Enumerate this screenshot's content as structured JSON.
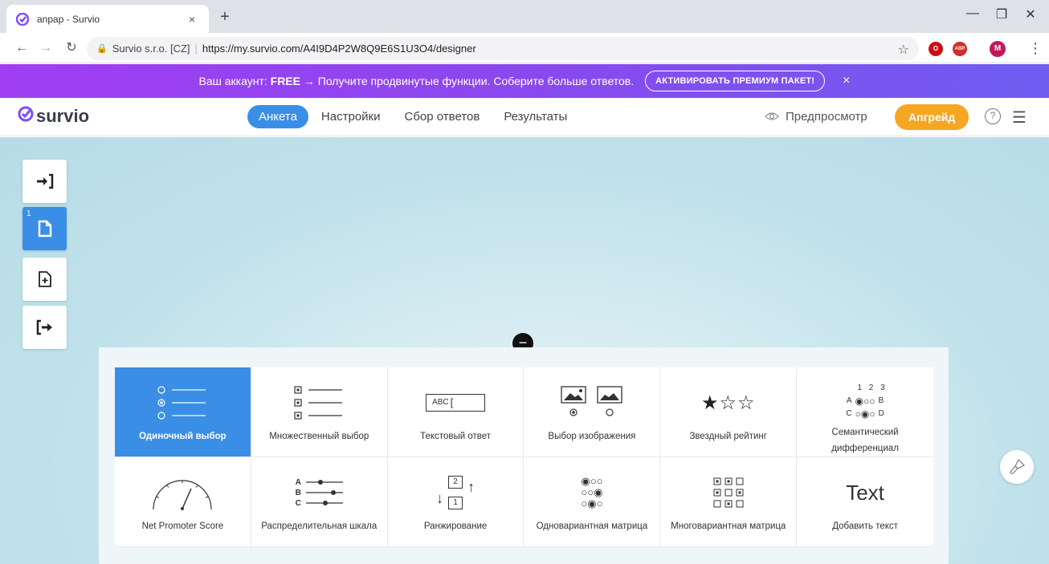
{
  "browser": {
    "tab_title": "anpap - Survio",
    "tab_close": "×",
    "new_tab": "+",
    "window_controls": {
      "minimize": "—",
      "restore": "❐",
      "close": "✕"
    },
    "nav": {
      "back": "←",
      "forward": "→",
      "reload": "↻"
    },
    "site_org": "Survio s.r.o. [CZ]",
    "url": "https://my.survio.com/A4I9D4P2W8Q9E6S1U3O4/designer",
    "extensions": [
      {
        "name": "opera-icon",
        "label": "O",
        "color": "#cc0f16"
      },
      {
        "name": "adblock-icon",
        "label": "ABP",
        "color": "#d62a2a"
      },
      {
        "name": "profile-avatar",
        "label": "M",
        "color": "#c2185b"
      }
    ]
  },
  "promo": {
    "text_prefix": "Ваш аккаунт:",
    "plan": "FREE",
    "text_suffix": "→ Получите продвинутые функции. Соберите больше ответов.",
    "cta": "АКТИВИРОВАТЬ ПРЕМИУМ ПАКЕТ!",
    "close": "×"
  },
  "header": {
    "logo": "survio",
    "tabs": [
      {
        "label": "Анкета",
        "active": true
      },
      {
        "label": "Настройки",
        "active": false
      },
      {
        "label": "Сбор ответов",
        "active": false
      },
      {
        "label": "Результаты",
        "active": false
      }
    ],
    "preview": "Предпросмотр",
    "upgrade": "Апгрейд",
    "help": "?"
  },
  "sidebar": {
    "page_number": "1",
    "buttons": [
      {
        "name": "sidebar-intro-button",
        "glyph": "→]"
      },
      {
        "name": "sidebar-page-button",
        "glyph": "page"
      },
      {
        "name": "sidebar-add-page-button",
        "glyph": "add-page"
      },
      {
        "name": "sidebar-end-button",
        "glyph": "[→"
      }
    ]
  },
  "question_types": [
    {
      "name": "single-choice",
      "label": "Одиночный выбор",
      "icon": "single-choice-icon",
      "active": true
    },
    {
      "name": "multiple-choice",
      "label": "Множественный выбор",
      "icon": "multiple-choice-icon",
      "active": false
    },
    {
      "name": "text-answer",
      "label": "Текстовый ответ",
      "icon": "text-answer-icon",
      "icon_text": "ABC",
      "active": false
    },
    {
      "name": "image-choice",
      "label": "Выбор изображения",
      "icon": "image-choice-icon",
      "active": false
    },
    {
      "name": "star-rating",
      "label": "Звездный рейтинг",
      "icon": "star-rating-icon",
      "active": false
    },
    {
      "name": "semantic-differential",
      "label": "Семантический дифференциал",
      "icon": "semantic-differential-icon",
      "icon_header": "1 2 3",
      "icon_rows": [
        [
          "A",
          "B"
        ],
        [
          "C",
          "D"
        ]
      ],
      "active": false
    },
    {
      "name": "net-promoter-score",
      "label": "Net Promoter Score",
      "icon": "nps-gauge-icon",
      "active": false
    },
    {
      "name": "distribution-scale",
      "label": "Распределительная шкала",
      "icon": "distribution-scale-icon",
      "icon_rows": [
        "A",
        "B",
        "C"
      ],
      "active": false
    },
    {
      "name": "ranking",
      "label": "Ранжирование",
      "icon": "ranking-icon",
      "icon_numbers": [
        "2",
        "1"
      ],
      "active": false
    },
    {
      "name": "single-matrix",
      "label": "Одновариантная матрица",
      "icon": "single-matrix-icon",
      "active": false
    },
    {
      "name": "multi-matrix",
      "label": "Многовариантная матрица",
      "icon": "multi-matrix-icon",
      "active": false
    },
    {
      "name": "add-text",
      "label": "Добавить текст",
      "icon": "add-text-icon",
      "icon_text": "Text",
      "active": false
    }
  ],
  "colors": {
    "accent": "#3a8ee6",
    "upgrade": "#f5a623",
    "promo_start": "#a13df2",
    "promo_end": "#6f5df0",
    "logo_mark": "#7c4dff"
  }
}
